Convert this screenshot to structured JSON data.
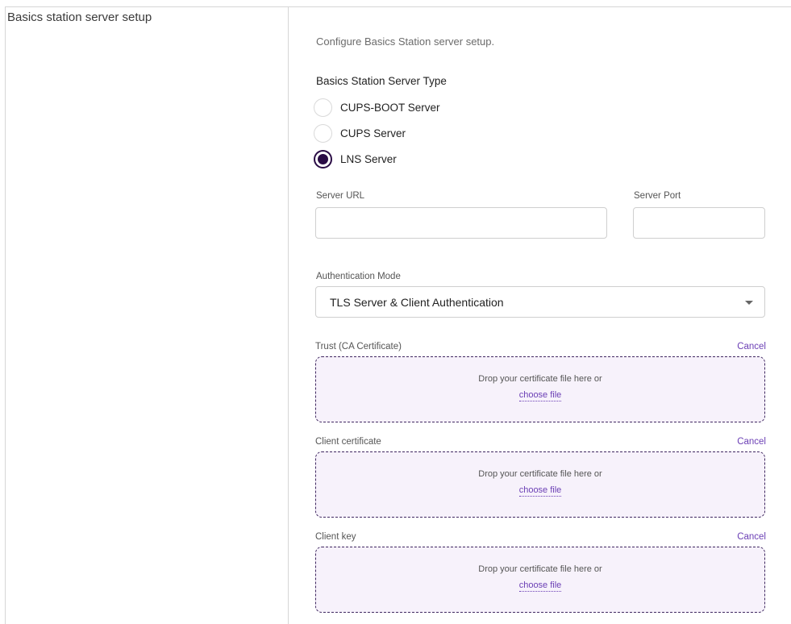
{
  "section": {
    "title": "Basics station server setup",
    "description": "Configure Basics Station server setup."
  },
  "server_type": {
    "label": "Basics Station Server Type",
    "options": [
      {
        "label": "CUPS-BOOT Server",
        "checked": false
      },
      {
        "label": "CUPS Server",
        "checked": false
      },
      {
        "label": "LNS Server",
        "checked": true
      }
    ]
  },
  "server_url": {
    "label": "Server URL",
    "value": ""
  },
  "server_port": {
    "label": "Server Port",
    "value": ""
  },
  "auth_mode": {
    "label": "Authentication Mode",
    "value": "TLS Server & Client Authentication"
  },
  "uploads": [
    {
      "label": "Trust (CA Certificate)",
      "cancel": "Cancel",
      "drop_text": "Drop your certificate file here or",
      "choose": "choose file"
    },
    {
      "label": "Client certificate",
      "cancel": "Cancel",
      "drop_text": "Drop your certificate file here or",
      "choose": "choose file"
    },
    {
      "label": "Client key",
      "cancel": "Cancel",
      "drop_text": "Drop your certificate file here or",
      "choose": "choose file"
    }
  ],
  "colors": {
    "accent": "#6b3fb5",
    "radio_selected": "#2a0c45",
    "dropzone_bg": "#f7f2fb",
    "dropzone_border": "#3f2760"
  }
}
